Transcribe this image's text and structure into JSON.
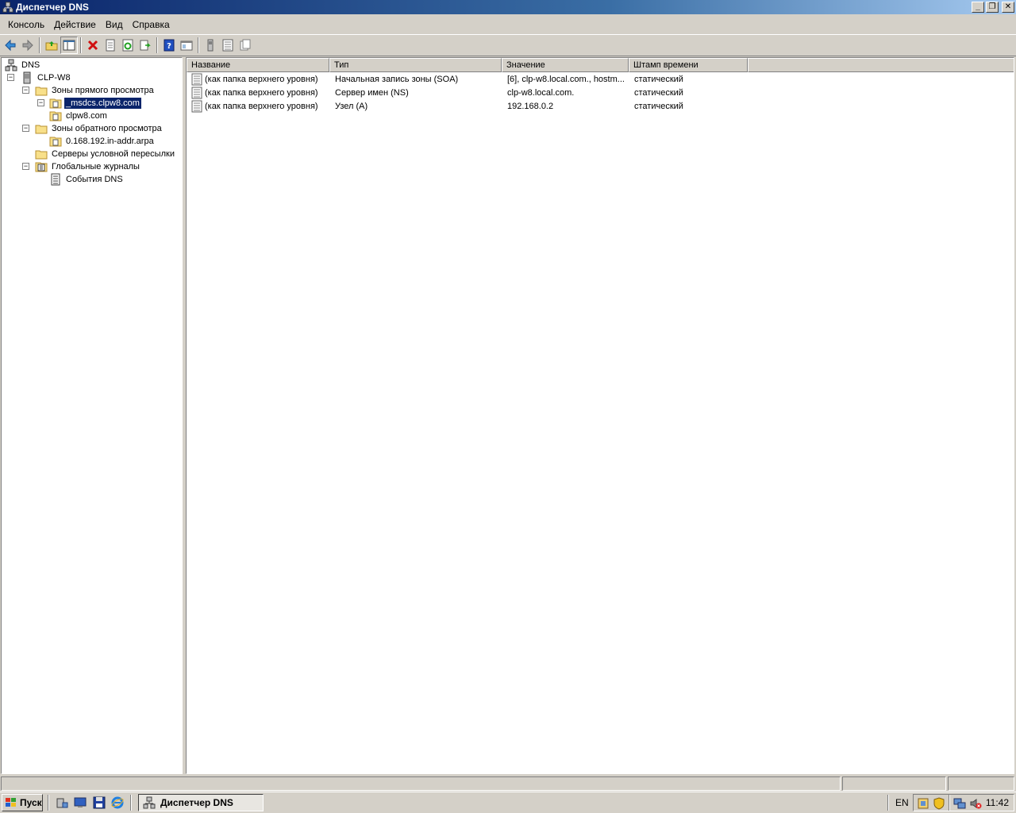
{
  "window": {
    "title": "Диспетчер DNS",
    "controls": [
      "minimize",
      "restore",
      "close"
    ]
  },
  "menu": {
    "items": [
      "Консоль",
      "Действие",
      "Вид",
      "Справка"
    ]
  },
  "toolbar": {
    "icons": [
      "back-icon",
      "forward-icon",
      "up-folder-icon",
      "show-hide-tree-icon",
      "delete-icon",
      "properties-icon",
      "refresh-icon",
      "export-list-icon",
      "help-icon",
      "console-icon",
      "server-icon",
      "zone-icon",
      "record-icon"
    ]
  },
  "tree": {
    "items": [
      {
        "label": "DNS",
        "icon": "dns-root-icon",
        "expander": ""
      },
      {
        "label": "CLP-W8",
        "icon": "server-icon",
        "expander": "−"
      },
      {
        "label": "Зоны прямого просмотра",
        "icon": "folder-icon",
        "expander": "−"
      },
      {
        "label": "_msdcs.clpw8.com",
        "icon": "zone-icon",
        "expander": "−",
        "selected": true
      },
      {
        "label": "clpw8.com",
        "icon": "zone-icon",
        "expander": ""
      },
      {
        "label": "Зоны обратного просмотра",
        "icon": "folder-icon",
        "expander": "−"
      },
      {
        "label": "0.168.192.in-addr.arpa",
        "icon": "zone-icon",
        "expander": ""
      },
      {
        "label": "Серверы условной пересылки",
        "icon": "folder-icon",
        "expander": ""
      },
      {
        "label": "Глобальные журналы",
        "icon": "log-folder-icon",
        "expander": "−"
      },
      {
        "label": "События DNS",
        "icon": "event-log-icon",
        "expander": ""
      }
    ]
  },
  "list": {
    "columns": [
      "Название",
      "Тип",
      "Значение",
      "Штамп времени"
    ],
    "rows": [
      {
        "name": "(как папка верхнего уровня)",
        "type": "Начальная запись зоны (SOA)",
        "value": "[6], clp-w8.local.com., hostm...",
        "timestamp": "статический"
      },
      {
        "name": "(как папка верхнего уровня)",
        "type": "Сервер имен (NS)",
        "value": "clp-w8.local.com.",
        "timestamp": "статический"
      },
      {
        "name": "(как папка верхнего уровня)",
        "type": "Узел (A)",
        "value": "192.168.0.2",
        "timestamp": "статический"
      }
    ]
  },
  "taskbar": {
    "start_label": "Пуск",
    "task_label": "Диспетчер DNS",
    "language": "EN",
    "clock": "11:42"
  },
  "colors": {
    "title_gradient_start": "#0a246a",
    "title_gradient_end": "#a6caf0",
    "selection": "#0a246a",
    "chrome": "#d4d0c8"
  }
}
